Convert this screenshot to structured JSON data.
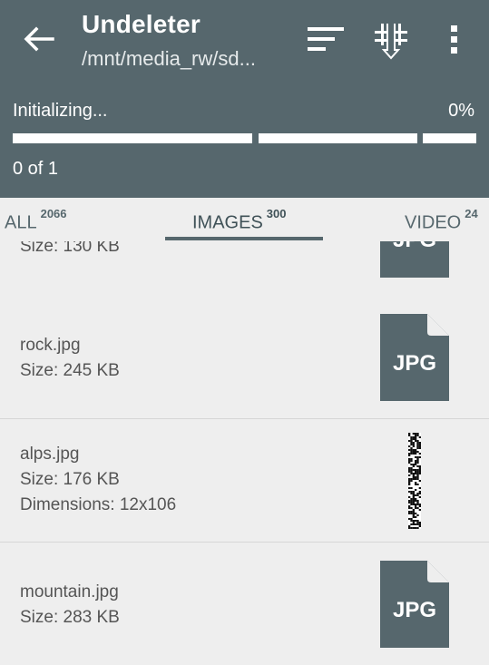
{
  "appbar": {
    "title": "Undeleter",
    "subtitle": "/mnt/media_rw/sd...",
    "status": "Initializing...",
    "percent": "0%",
    "count": "0 of 1",
    "progress_value": 0
  },
  "tabs": [
    {
      "label": "ALL",
      "count": "2066"
    },
    {
      "label": "IMAGES",
      "count": "300"
    },
    {
      "label": "VIDEO",
      "count": "24"
    }
  ],
  "files": [
    {
      "name": "",
      "size": "Size: 130 KB",
      "dimensions": "",
      "thumb": "jpg-file-icon"
    },
    {
      "name": "rock.jpg",
      "size": "Size: 245 KB",
      "dimensions": "",
      "thumb": "jpg-file-icon"
    },
    {
      "name": "alps.jpg",
      "size": "Size: 176 KB",
      "dimensions": "Dimensions: 12x106",
      "thumb": "image-thumbnail"
    },
    {
      "name": "mountain.jpg",
      "size": "Size: 283 KB",
      "dimensions": "",
      "thumb": "jpg-file-icon"
    }
  ],
  "jpg_icon_label": "JPG",
  "colors": {
    "toolbar": "#56676d",
    "background": "#eeeeee",
    "text_secondary": "#555555",
    "icon": "#56676d"
  }
}
